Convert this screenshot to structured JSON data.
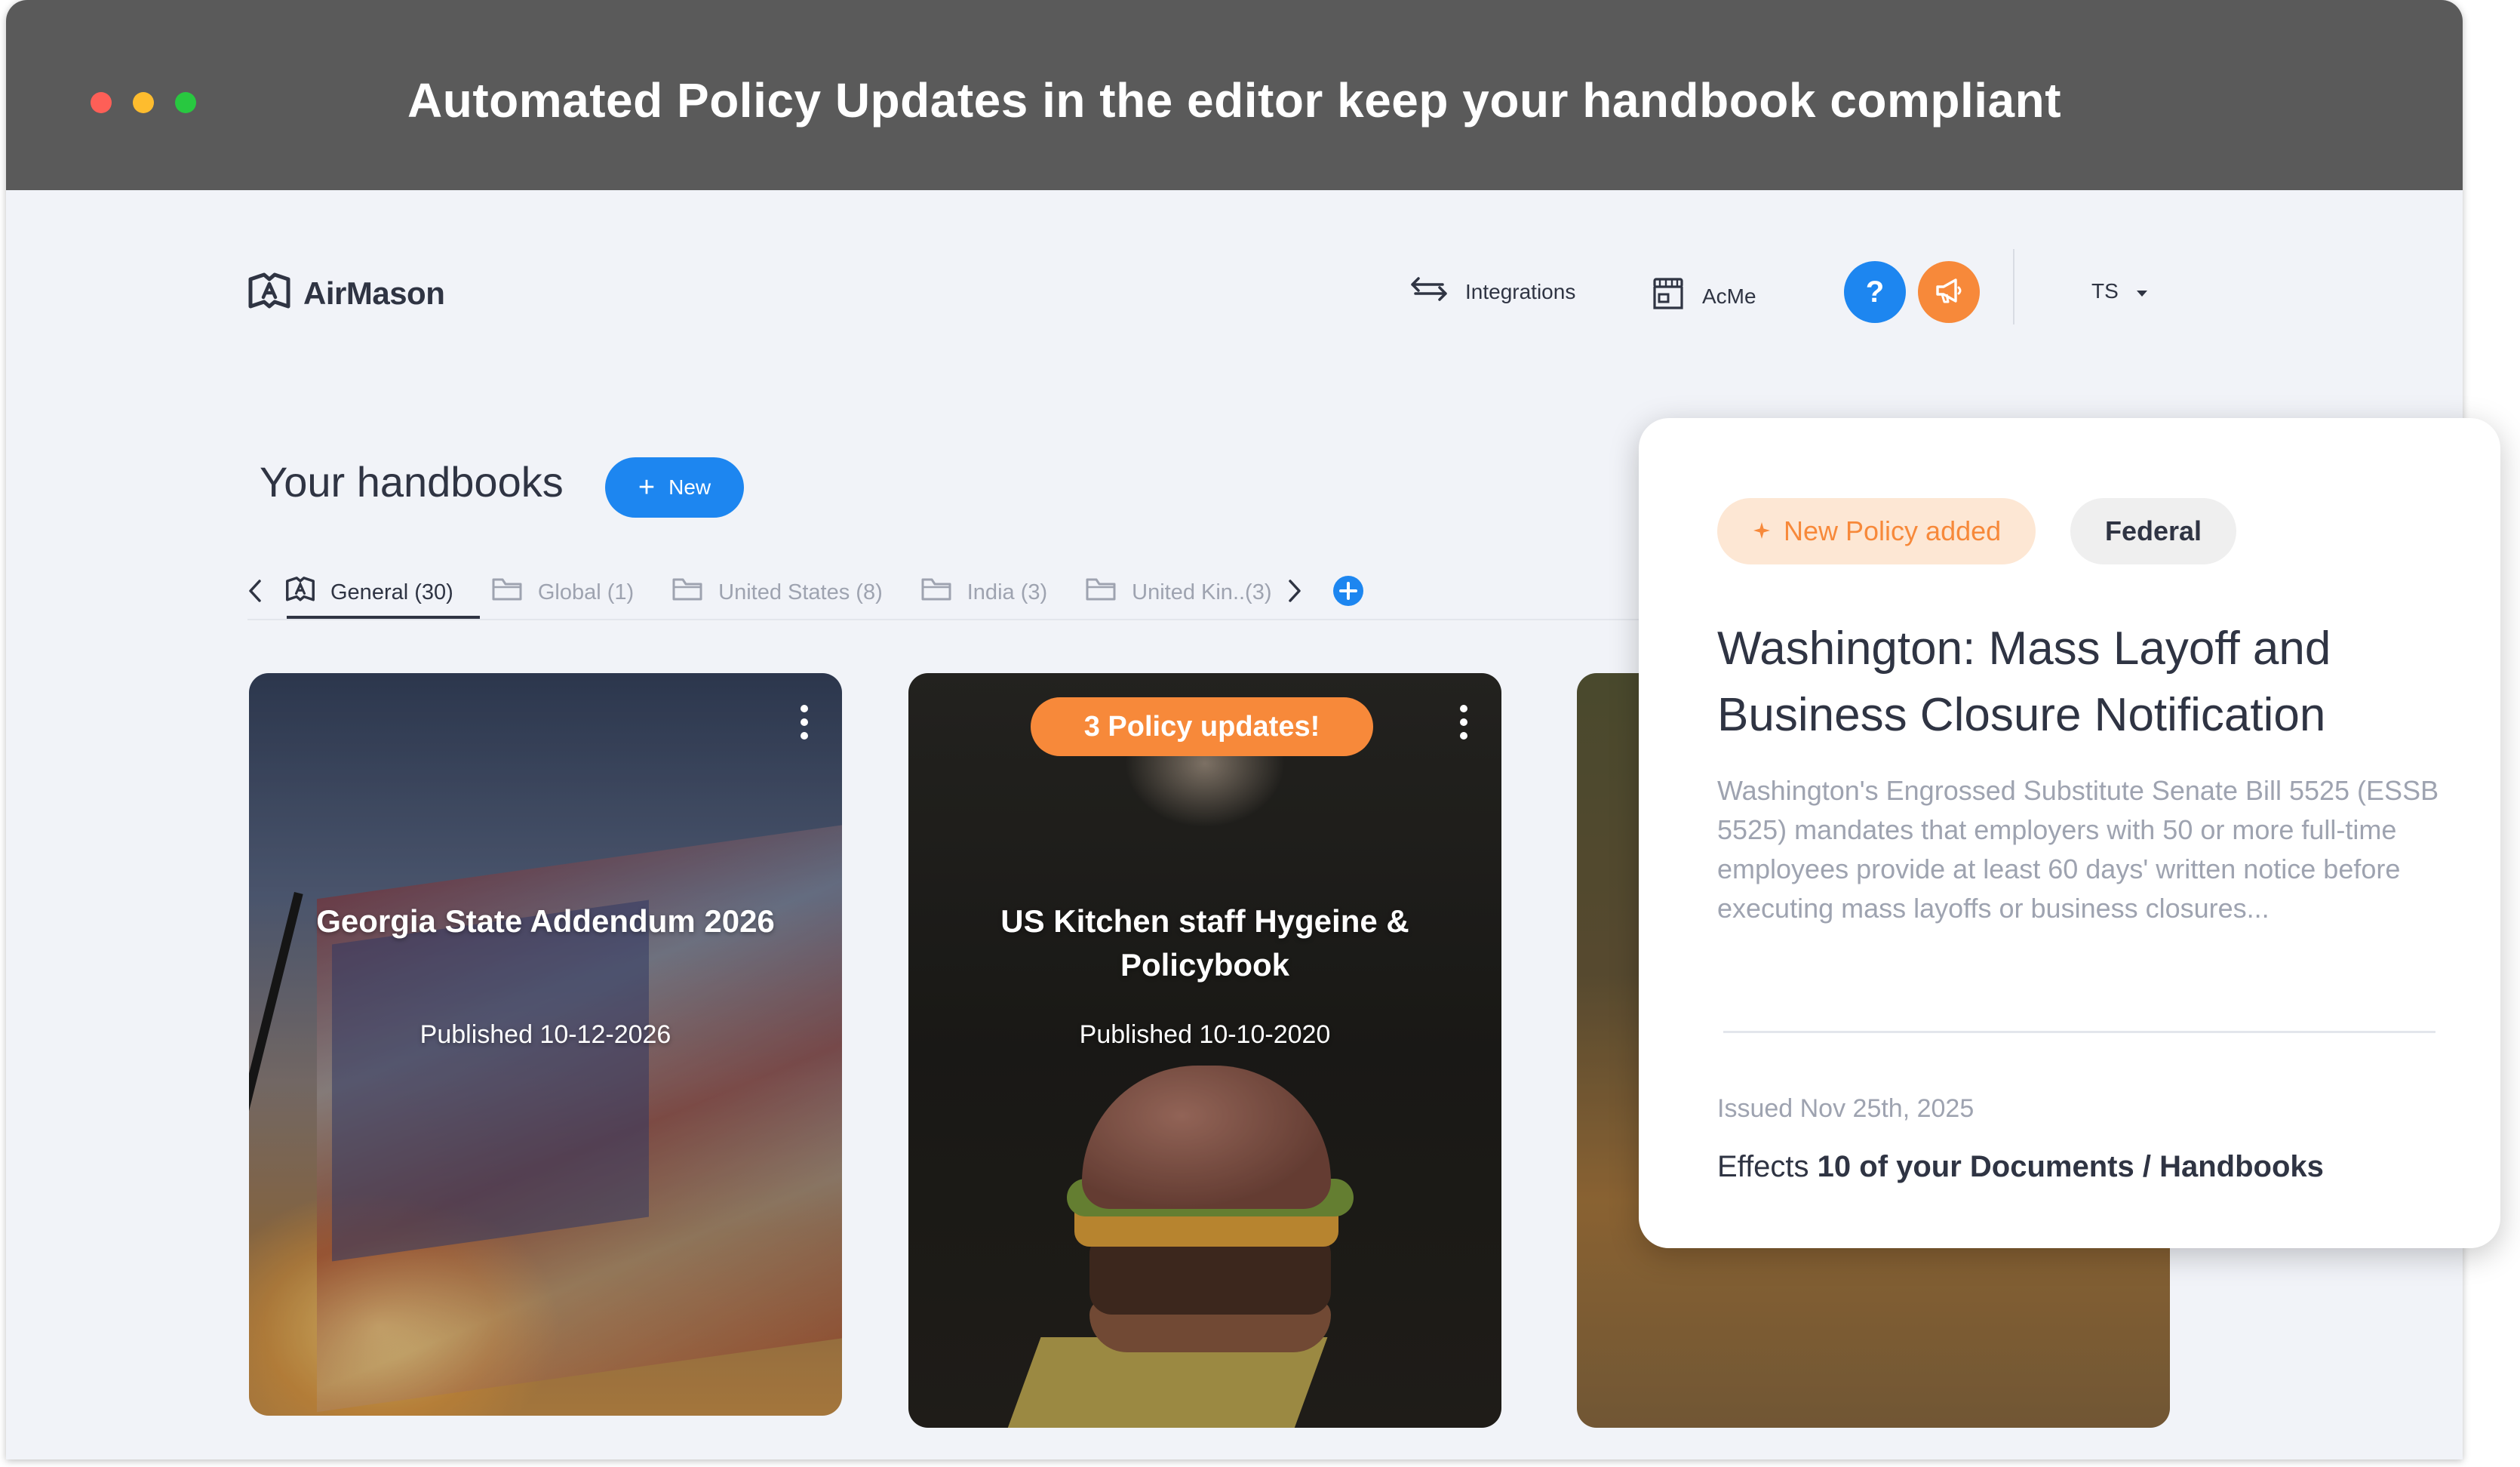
{
  "window": {
    "title": "Automated Policy Updates in the editor keep your handbook compliant"
  },
  "header": {
    "logo": "AirMason",
    "nav": [
      {
        "label": "Integrations",
        "icon": "arrows-exchange-icon"
      },
      {
        "label": "AcMe",
        "icon": "storefront-icon"
      }
    ],
    "help_label": "?",
    "user_initials": "TS"
  },
  "handbooks": {
    "title": "Your handbooks",
    "new_button": "New",
    "tabs": [
      {
        "label": "General (30)",
        "active": true,
        "icon": "handbook-icon"
      },
      {
        "label": "Global (1)",
        "active": false,
        "icon": "folder-icon"
      },
      {
        "label": "United States (8)",
        "active": false,
        "icon": "folder-icon"
      },
      {
        "label": "India (3)",
        "active": false,
        "icon": "folder-icon"
      },
      {
        "label": "United Kin..(3)",
        "active": false,
        "icon": "folder-icon"
      }
    ],
    "cards": [
      {
        "title": "Georgia State Addendum 2026",
        "date": "Published 10-12-2026"
      },
      {
        "title": "US Kitchen staff Hygeine & Policybook",
        "date": "Published 10-10-2020",
        "badge": "3 Policy updates!"
      },
      {
        "title": "",
        "date": ""
      }
    ]
  },
  "popover": {
    "tag_new": "New Policy added",
    "tag_category": "Federal",
    "title": "Washington: Mass Layoff and Business Closure Notification",
    "description": "Washington's Engrossed Substitute Senate Bill 5525 (ESSB 5525) mandates that employers with 50 or more full-time employees provide at least 60 days' written notice before executing mass layoffs or business closures...",
    "issued": "Issued Nov 25th, 2025",
    "effects_prefix": "Effects ",
    "effects_bold": "10 of your Documents / Handbooks"
  },
  "colors": {
    "accent_blue": "#1d86f0",
    "accent_orange": "#f7893a",
    "text_dark": "#2f3443",
    "text_muted": "#9ea3b0"
  }
}
